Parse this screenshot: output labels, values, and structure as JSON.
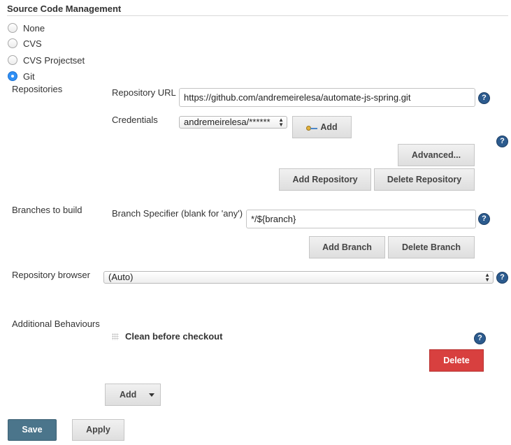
{
  "section": {
    "title": "Source Code Management"
  },
  "scm_options": [
    {
      "label": "None",
      "checked": false
    },
    {
      "label": "CVS",
      "checked": false
    },
    {
      "label": "CVS Projectset",
      "checked": false
    },
    {
      "label": "Git",
      "checked": true
    }
  ],
  "repositories": {
    "label": "Repositories",
    "url_label": "Repository URL",
    "url_value": "https://github.com/andremeirelesa/automate-js-spring.git",
    "credentials_label": "Credentials",
    "credentials_value": "andremeirelesa/******",
    "add_credentials_label": "Add",
    "advanced_label": "Advanced...",
    "add_repository_label": "Add Repository",
    "delete_repository_label": "Delete Repository"
  },
  "branches": {
    "label": "Branches to build",
    "specifier_label": "Branch Specifier (blank for 'any')",
    "specifier_value": "*/${branch}",
    "add_branch_label": "Add Branch",
    "delete_branch_label": "Delete Branch"
  },
  "repository_browser": {
    "label": "Repository browser",
    "value": "(Auto)"
  },
  "additional_behaviours": {
    "label": "Additional Behaviours",
    "item_title": "Clean before checkout",
    "delete_label": "Delete",
    "add_label": "Add"
  },
  "footer": {
    "save_label": "Save",
    "apply_label": "Apply"
  },
  "help_icon_glyph": "?",
  "colors": {
    "primary": "#4b758b",
    "danger": "#d8403f",
    "help": "#2c5b8e",
    "radio_checked": "#2f8ff5"
  }
}
